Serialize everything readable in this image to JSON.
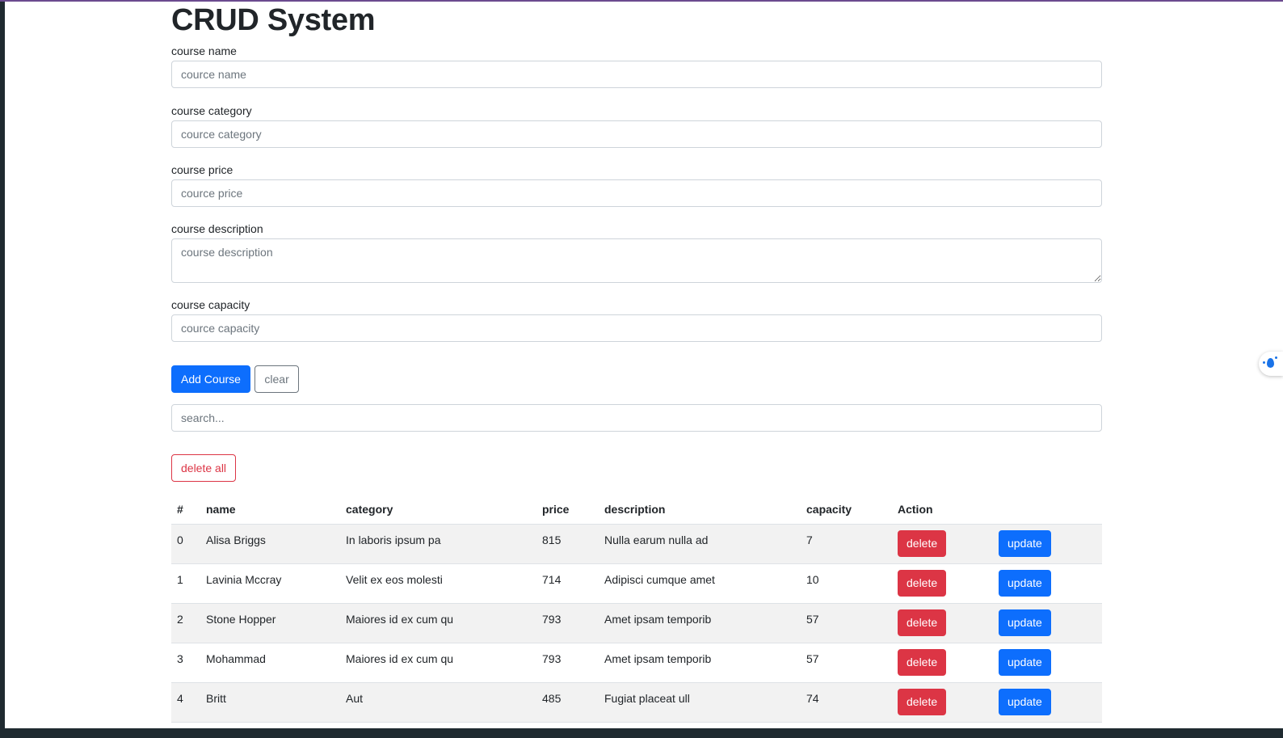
{
  "title": "CRUD System",
  "form": {
    "name": {
      "label": "course name",
      "placeholder": "cource name"
    },
    "category": {
      "label": "course category",
      "placeholder": "cource category"
    },
    "price": {
      "label": "course price",
      "placeholder": "cource price"
    },
    "description": {
      "label": "course description",
      "placeholder": "course description"
    },
    "capacity": {
      "label": "course capacity",
      "placeholder": "cource capacity"
    }
  },
  "buttons": {
    "add": "Add Course",
    "clear": "clear",
    "delete_all": "delete all"
  },
  "search": {
    "placeholder": "search..."
  },
  "table": {
    "headers": [
      "#",
      "name",
      "category",
      "price",
      "description",
      "capacity",
      "Action"
    ],
    "rows": [
      {
        "index": "0",
        "name": "Alisa Briggs",
        "category": "In laboris ipsum pa",
        "price": "815",
        "description": "Nulla earum nulla ad",
        "capacity": "7",
        "delete": "delete",
        "update": "update"
      },
      {
        "index": "1",
        "name": "Lavinia Mccray",
        "category": "Velit ex eos molesti",
        "price": "714",
        "description": "Adipisci cumque amet",
        "capacity": "10",
        "delete": "delete",
        "update": "update"
      },
      {
        "index": "2",
        "name": "Stone Hopper",
        "category": "Maiores id ex cum qu",
        "price": "793",
        "description": "Amet ipsam temporib",
        "capacity": "57",
        "delete": "delete",
        "update": "update"
      },
      {
        "index": "3",
        "name": "Mohammad",
        "category": "Maiores id ex cum qu",
        "price": "793",
        "description": "Amet ipsam temporib",
        "capacity": "57",
        "delete": "delete",
        "update": "update"
      },
      {
        "index": "4",
        "name": "Britt",
        "category": "Aut",
        "price": "485",
        "description": "Fugiat placeat ull",
        "capacity": "74",
        "delete": "delete",
        "update": "update"
      }
    ]
  },
  "colors": {
    "primary": "#0d6efd",
    "danger": "#dc3545",
    "secondary": "#6c757d"
  },
  "side_widget": {
    "icon": "sparkle-drop-icon"
  }
}
